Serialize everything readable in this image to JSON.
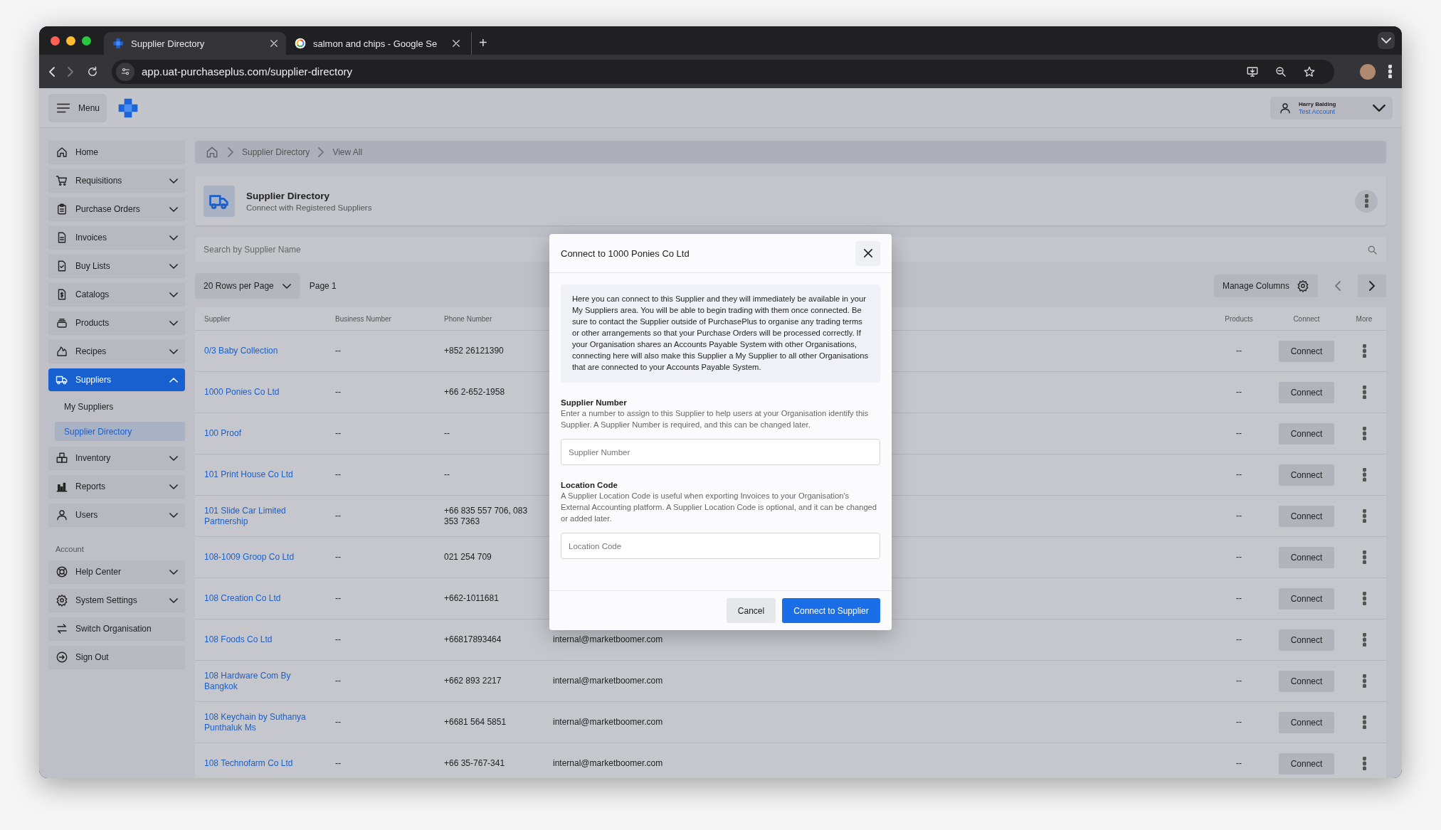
{
  "browser": {
    "tabs": [
      {
        "title": "Supplier Directory",
        "selected": true
      },
      {
        "title": "salmon and chips - Google Se",
        "selected": false
      }
    ],
    "new_tab": "+",
    "url": "app.uat-purchaseplus.com/supplier-directory"
  },
  "topbar": {
    "menu_label": "Menu",
    "user": {
      "name": "Harry Balding",
      "account": "Test Account"
    }
  },
  "sidebar": {
    "items": [
      {
        "label": "Home",
        "kind": "link",
        "selected": false
      },
      {
        "label": "Requisitions",
        "kind": "group",
        "selected": false,
        "expanded": false
      },
      {
        "label": "Purchase Orders",
        "kind": "group",
        "selected": false,
        "expanded": false
      },
      {
        "label": "Invoices",
        "kind": "group",
        "selected": false,
        "expanded": false
      },
      {
        "label": "Buy Lists",
        "kind": "group",
        "selected": false,
        "expanded": false
      },
      {
        "label": "Catalogs",
        "kind": "group",
        "selected": false,
        "expanded": false
      },
      {
        "label": "Products",
        "kind": "group",
        "selected": false,
        "expanded": false
      },
      {
        "label": "Recipes",
        "kind": "group",
        "selected": false,
        "expanded": false
      },
      {
        "label": "Suppliers",
        "kind": "group",
        "selected": true,
        "expanded": true,
        "children": [
          {
            "label": "My Suppliers",
            "selected": false
          },
          {
            "label": "Supplier Directory",
            "selected": true
          }
        ]
      },
      {
        "label": "Inventory",
        "kind": "group",
        "selected": false,
        "expanded": false
      },
      {
        "label": "Reports",
        "kind": "group",
        "selected": false,
        "expanded": false
      },
      {
        "label": "Users",
        "kind": "group",
        "selected": false,
        "expanded": false
      }
    ],
    "account_heading": "Account",
    "account_items": [
      {
        "label": "Help Center",
        "kind": "group",
        "selected": false,
        "expanded": false
      },
      {
        "label": "System Settings",
        "kind": "group",
        "selected": false,
        "expanded": false
      },
      {
        "label": "Switch Organisation",
        "kind": "link",
        "selected": false
      },
      {
        "label": "Sign Out",
        "kind": "link",
        "selected": false
      }
    ]
  },
  "breadcrumb": [
    "Supplier Directory",
    "View All"
  ],
  "page_header": {
    "title": "Supplier Directory",
    "subtitle": "Connect with Registered Suppliers"
  },
  "search": {
    "placeholder": "Search by Supplier Name"
  },
  "toolbar": {
    "rows_per_page": "20 Rows per Page",
    "page": "Page 1",
    "manage_columns": "Manage Columns"
  },
  "table": {
    "columns": [
      "Supplier",
      "Business Number",
      "Phone Number",
      "Products",
      "Connect",
      "More"
    ],
    "rows": [
      {
        "supplier": "0/3 Baby Collection",
        "business_number": "--",
        "phone": "+852 26121390",
        "products": "--",
        "action": "Connect"
      },
      {
        "supplier": "1000 Ponies Co Ltd",
        "business_number": "--",
        "phone": "+66 2-652-1958",
        "products": "--",
        "action": "Connect"
      },
      {
        "supplier": "100 Proof",
        "business_number": "--",
        "phone": "--",
        "products": "--",
        "action": "Connect"
      },
      {
        "supplier": "101 Print House Co Ltd",
        "business_number": "--",
        "phone": "--",
        "products": "--",
        "action": "Connect"
      },
      {
        "supplier": "101 Slide Car Limited Partnership",
        "business_number": "--",
        "phone": "+66 835 557 706, 083 353 7363",
        "products": "--",
        "action": "Connect"
      },
      {
        "supplier": "108-1009 Groop Co Ltd",
        "business_number": "--",
        "phone": "021 254 709",
        "products": "--",
        "action": "Connect"
      },
      {
        "supplier": "108 Creation Co Ltd",
        "business_number": "--",
        "phone": "+662-1011681",
        "products": "--",
        "action": "Connect"
      },
      {
        "supplier": "108 Foods Co Ltd",
        "business_number": "--",
        "phone": "+66817893464",
        "email": "internal@marketboomer.com",
        "products": "--",
        "action": "Connect"
      },
      {
        "supplier": "108 Hardware Com By Bangkok",
        "business_number": "--",
        "phone": "+662 893 2217",
        "email": "internal@marketboomer.com",
        "products": "--",
        "action": "Connect"
      },
      {
        "supplier": "108 Keychain by Suthanya Punthaluk Ms",
        "business_number": "--",
        "phone": "+6681 564 5851",
        "email": "internal@marketboomer.com",
        "products": "--",
        "action": "Connect"
      },
      {
        "supplier": "108 Technofarm Co Ltd",
        "business_number": "--",
        "phone": "+66 35-767-341",
        "email": "internal@marketboomer.com",
        "products": "--",
        "action": "Connect"
      }
    ]
  },
  "modal": {
    "title": "Connect to 1000 Ponies Co Ltd",
    "info": "Here you can connect to this Supplier and they will immediately be available in your My Suppliers area. You will be able to begin trading with them once connected. Be sure to contact the Supplier outside of PurchasePlus to organise any trading terms or other arrangements so that your Purchase Orders will be processed correctly. If your Organisation shares an Accounts Payable System with other Organisations, connecting here will also make this Supplier a My Supplier to all other Organisations that are connected to your Accounts Payable System.",
    "fields": [
      {
        "label": "Supplier Number",
        "help": "Enter a number to assign to this Supplier to help users at your Organisation identify this Supplier. A Supplier Number is required, and this can be changed later.",
        "placeholder": "Supplier Number"
      },
      {
        "label": "Location Code",
        "help": "A Supplier Location Code is useful when exporting Invoices to your Organisation's External Accounting platform. A Supplier Location Code is optional, and it can be changed or added later.",
        "placeholder": "Location Code"
      }
    ],
    "cancel": "Cancel",
    "confirm": "Connect to Supplier"
  }
}
